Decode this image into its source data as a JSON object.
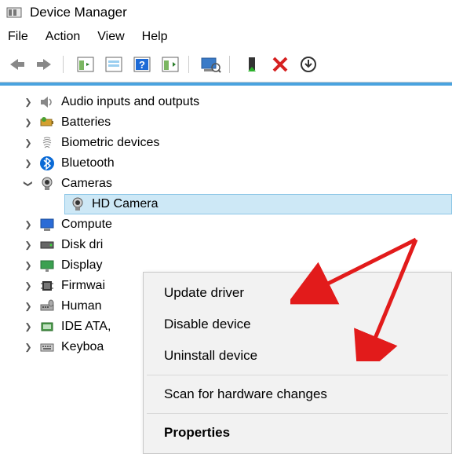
{
  "window": {
    "title": "Device Manager"
  },
  "menu": {
    "file": "File",
    "action": "Action",
    "view": "View",
    "help": "Help"
  },
  "tree": {
    "items": [
      {
        "label": "Audio inputs and outputs",
        "icon": "speaker"
      },
      {
        "label": "Batteries",
        "icon": "battery"
      },
      {
        "label": "Biometric devices",
        "icon": "fingerprint"
      },
      {
        "label": "Bluetooth",
        "icon": "bluetooth"
      },
      {
        "label": "Cameras",
        "icon": "camera",
        "expanded": true,
        "child": {
          "label": "HD Camera",
          "icon": "camera"
        }
      },
      {
        "label": "Compute",
        "icon": "monitor"
      },
      {
        "label": "Disk dri",
        "icon": "drive"
      },
      {
        "label": "Display",
        "icon": "display"
      },
      {
        "label": "Firmwai",
        "icon": "chip"
      },
      {
        "label": "Human",
        "icon": "hid"
      },
      {
        "label": "IDE ATA,",
        "icon": "ide"
      },
      {
        "label": "Keyboa",
        "icon": "keyboard"
      }
    ]
  },
  "ctx": {
    "update": "Update driver",
    "disable": "Disable device",
    "uninstall": "Uninstall device",
    "scan": "Scan for hardware changes",
    "properties": "Properties"
  }
}
